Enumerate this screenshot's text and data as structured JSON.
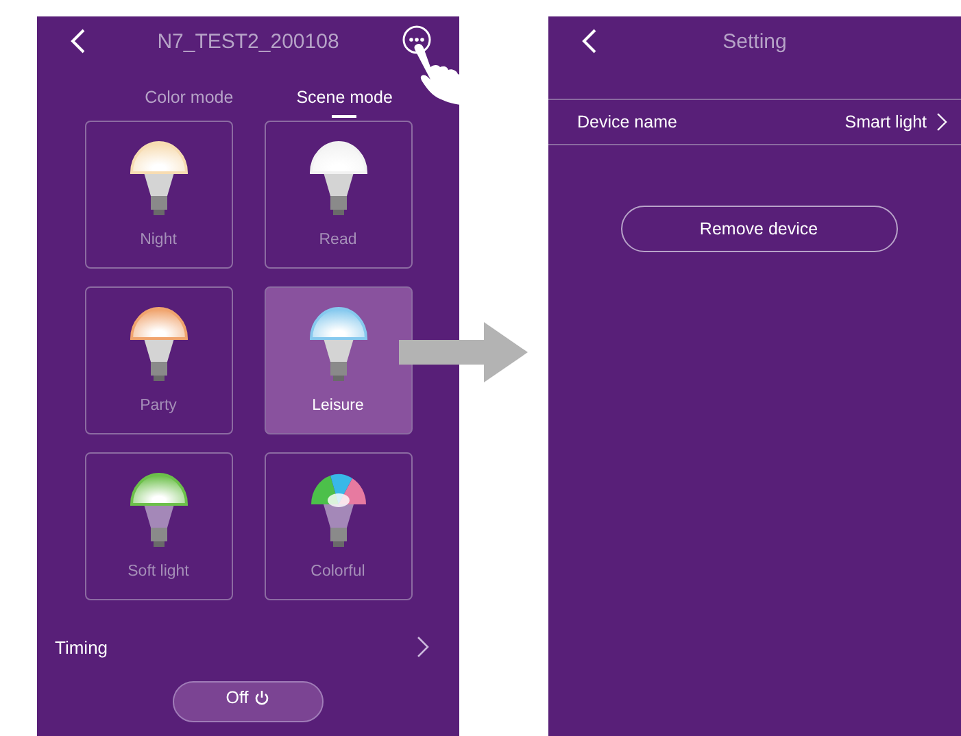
{
  "main_screen": {
    "title": "N7_TEST2_200108",
    "mode_tabs": [
      {
        "label": "Color mode",
        "selected": false
      },
      {
        "label": "Scene mode",
        "selected": true
      }
    ],
    "scenes": [
      {
        "label": "Night",
        "selected": false,
        "kind": "solid",
        "color": "#f7dcb2"
      },
      {
        "label": "Read",
        "selected": false,
        "kind": "solid",
        "color": "#f2f2f2"
      },
      {
        "label": "Party",
        "selected": false,
        "kind": "solid",
        "color": "#f0a46e"
      },
      {
        "label": "Leisure",
        "selected": true,
        "kind": "solid",
        "color": "#86c9ee"
      },
      {
        "label": "Soft light",
        "selected": false,
        "kind": "solid",
        "color": "#6cc04a"
      },
      {
        "label": "Colorful",
        "selected": false,
        "kind": "multicolor",
        "color": "#e77aa0"
      }
    ],
    "timing": {
      "label": "Timing"
    },
    "power_button": {
      "label": "Off"
    }
  },
  "settings_screen": {
    "title": "Setting",
    "device_name": {
      "label": "Device name",
      "value": "Smart light"
    },
    "remove_button": {
      "label": "Remove device"
    }
  }
}
